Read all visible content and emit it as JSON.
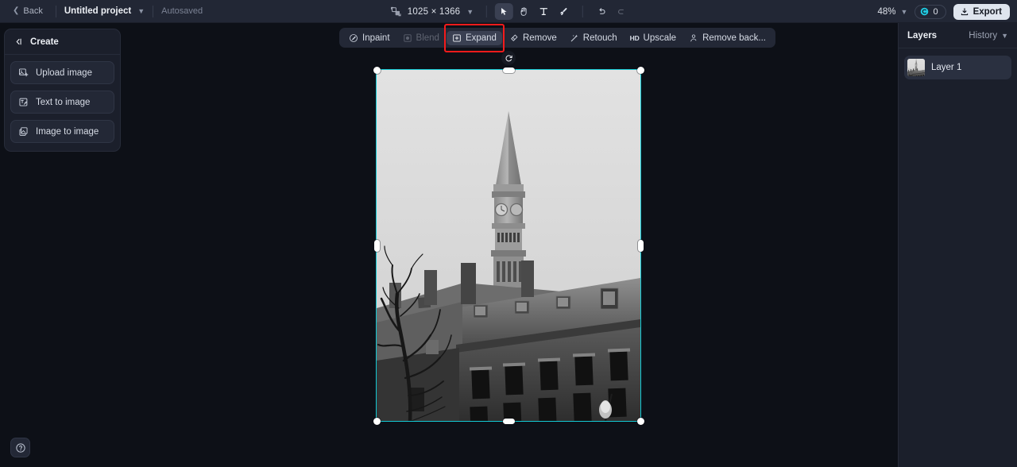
{
  "topbar": {
    "back_label": "Back",
    "project_name": "Untitled project",
    "autosaved_label": "Autosaved",
    "canvas_size": "1025 × 1366",
    "zoom_level": "48%",
    "credits_count": "0",
    "export_label": "Export",
    "tools": [
      {
        "name": "select-tool",
        "icon": "cursor-icon",
        "active": true,
        "disabled": false
      },
      {
        "name": "hand-tool",
        "icon": "hand-icon",
        "active": false,
        "disabled": false
      },
      {
        "name": "text-tool",
        "icon": "text-icon",
        "active": false,
        "disabled": false
      },
      {
        "name": "brush-tool",
        "icon": "brush-icon",
        "active": false,
        "disabled": false
      },
      {
        "name": "undo-button",
        "icon": "undo-icon",
        "active": false,
        "disabled": false
      },
      {
        "name": "redo-button",
        "icon": "redo-icon",
        "active": false,
        "disabled": true
      }
    ]
  },
  "create_panel": {
    "title": "Create",
    "collapse_icon": "collapse-left-icon",
    "items": [
      {
        "label": "Upload image",
        "icon": "upload-image-icon"
      },
      {
        "label": "Text to image",
        "icon": "text-to-image-icon"
      },
      {
        "label": "Image to image",
        "icon": "image-to-image-icon"
      }
    ]
  },
  "canvas_toolbar": {
    "items": [
      {
        "label": "Inpaint",
        "icon": "inpaint-icon",
        "disabled": false,
        "active": false,
        "highlighted": false
      },
      {
        "label": "Blend",
        "icon": "blend-icon",
        "disabled": true,
        "active": false,
        "highlighted": false
      },
      {
        "label": "Expand",
        "icon": "expand-icon",
        "disabled": false,
        "active": true,
        "highlighted": true
      },
      {
        "label": "Remove",
        "icon": "eraser-icon",
        "disabled": false,
        "active": false,
        "highlighted": false
      },
      {
        "label": "Retouch",
        "icon": "magic-wand-icon",
        "disabled": false,
        "active": false,
        "highlighted": false
      },
      {
        "label": "Upscale",
        "icon": "hd-icon",
        "disabled": false,
        "active": false,
        "highlighted": false
      },
      {
        "label": "Remove back...",
        "icon": "remove-background-icon",
        "disabled": false,
        "active": false,
        "highlighted": false
      }
    ]
  },
  "layers_panel": {
    "title": "Layers",
    "history_label": "History",
    "layers": [
      {
        "name": "Layer 1"
      }
    ]
  },
  "help": {
    "icon": "help-circle-icon"
  },
  "colors": {
    "accent_selection": "#13c9d4",
    "highlight_box": "#f51b1b",
    "topbar_bg": "#222735",
    "panel_bg": "#1b1f2b",
    "canvas_bg": "#0d1017",
    "credit_icon": "#21c9e0"
  }
}
